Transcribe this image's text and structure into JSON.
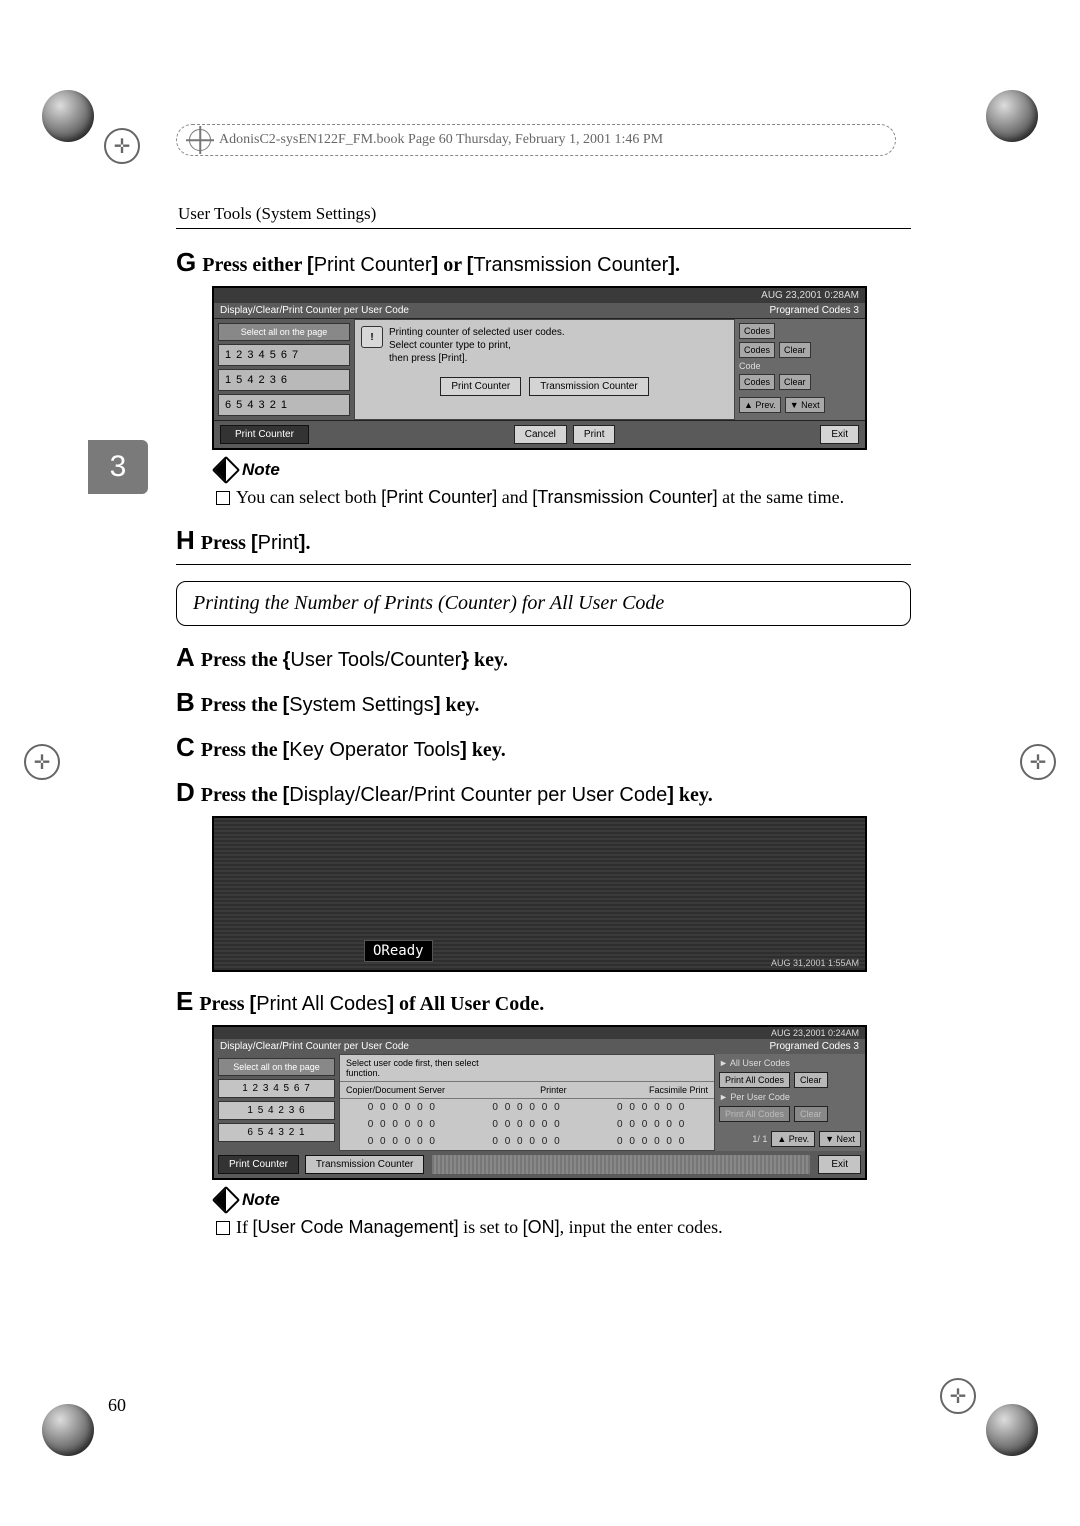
{
  "header_book_line": "AdonisC2-sysEN122F_FM.book  Page 60  Thursday, February 1, 2001  1:46 PM",
  "running_head": "User Tools (System Settings)",
  "side_chapter_num": "3",
  "page_number": "60",
  "step_G": {
    "letter": "G",
    "pre": "Press either ",
    "btn1_open": "[",
    "btn1": "Print Counter",
    "btn1_close": "]",
    "mid": " or ",
    "btn2_open": "[",
    "btn2": "Transmission Counter",
    "btn2_close": "]",
    "end": "."
  },
  "shot1": {
    "date": "AUG  23,2001  0:28AM",
    "title": "Display/Clear/Print Counter per User Code",
    "programed": "Programed Codes   3",
    "left_tab": "Select all on the page",
    "codes": [
      "1 2 3 4 5 6 7",
      "1 5 4 2 3 6",
      "6 5 4 3 2 1"
    ],
    "msg1": "Printing counter of selected user codes.",
    "msg2": "Select counter type to print,",
    "msg3": "then press [Print].",
    "btn_pc": "Print Counter",
    "btn_tc": "Transmission Counter",
    "right_codes": "Codes",
    "right_clear": "Clear",
    "right_code": "Code",
    "prev": "▲ Prev.",
    "next": "▼ Next",
    "foot_print": "Print Counter",
    "cancel": "Cancel",
    "print": "Print",
    "exit": "Exit"
  },
  "note1_label": "Note",
  "note1_body_pre": "You can select both ",
  "note1_b1": "[Print Counter]",
  "note1_mid": " and ",
  "note1_b2": "[Transmission Counter]",
  "note1_post": " at the same time.",
  "step_H": {
    "letter": "H",
    "pre": "Press ",
    "btn_open": "[",
    "btn": "Print",
    "btn_close": "]",
    "end": "."
  },
  "section_title": "Printing the Number of Prints (Counter) for All User Code",
  "step_A": {
    "letter": "A",
    "pre": "Press the ",
    "key_open": "{",
    "key": "User Tools/Counter",
    "key_close": "}",
    "end": " key."
  },
  "step_B": {
    "letter": "B",
    "pre": "Press the ",
    "btn_open": "[",
    "btn": "System Settings",
    "btn_close": "]",
    "end": " key."
  },
  "step_C": {
    "letter": "C",
    "pre": "Press the ",
    "btn_open": "[",
    "btn": "Key Operator Tools",
    "btn_close": "]",
    "end": " key."
  },
  "step_D": {
    "letter": "D",
    "pre": "Press the ",
    "btn_open": "[",
    "btn": "Display/Clear/Print Counter per User Code",
    "btn_close": "]",
    "end": " key."
  },
  "ss2_ready": "OReady",
  "ss2_date": "AUG  31,2001  1:55AM",
  "step_E": {
    "letter": "E",
    "pre": "Press ",
    "btn_open": "[",
    "btn": "Print All Codes",
    "btn_close": "]",
    "end": " of All User Code."
  },
  "ss3": {
    "date": "AUG  23,2001  0:24AM",
    "title": "Display/Clear/Print Counter per User Code",
    "programed": "Programed Codes   3",
    "left_tab": "Select all on the page",
    "hint": "Select user code first, then select function.",
    "col1": "Copier/Document Server",
    "col2": "Printer",
    "col3": "Facsimile Print",
    "codes": [
      "1 2 3 4 5 6 7",
      "1 5 4 2 3 6",
      "6 5 4 3 2 1"
    ],
    "cell": "0 0 0 0 0 0",
    "grp_all": "► All User Codes",
    "btn_pac": "Print All Codes",
    "btn_clear": "Clear",
    "grp_per": "► Per User Code",
    "btn_pac2": "Print All Codes",
    "btn_clear2": "Clear",
    "pager": "1/  1",
    "prev": "▲ Prev.",
    "next": "▼ Next",
    "foot_print": "Print Counter",
    "foot_trans": "Transmission Counter",
    "exit": "Exit"
  },
  "note2_label": "Note",
  "note2_pre": "If ",
  "note2_b1": "[User Code Management]",
  "note2_mid": " is set to ",
  "note2_b2": "[ON]",
  "note2_post": ", input the enter codes."
}
